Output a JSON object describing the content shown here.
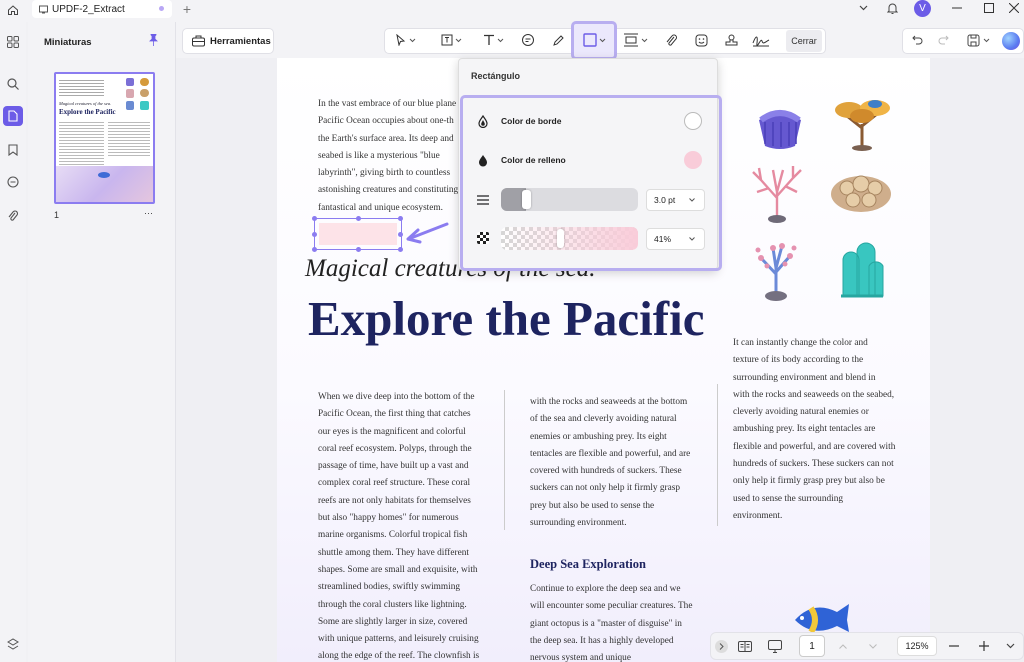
{
  "tab": {
    "title": "UPDF-2_Extract"
  },
  "thumbnails": {
    "title": "Miniaturas",
    "page_number": "1",
    "more": "···",
    "mini_subtitle": "Magical creatures of the sea.",
    "mini_title": "Explore the Pacific"
  },
  "toolbar": {
    "tools_label": "Herramientas",
    "close_label": "Cerrar"
  },
  "popup": {
    "title": "Rectángulo",
    "border_color_label": "Color de borde",
    "fill_color_label": "Color de relleno",
    "thickness_value": "3.0 pt",
    "opacity_value": "41%",
    "thickness_level": 0.15,
    "opacity_level": 0.41,
    "border_color": "#ffffff",
    "fill_color": "#f9ccd9"
  },
  "page": {
    "intro_lines": [
      "In the vast embrace of our blue plane",
      "Pacific Ocean occupies about one-th",
      "the Earth's surface area. Its deep and",
      "seabed is like a mysterious \"blue",
      "labyrinth\", giving birth to countless",
      "astonishing creatures and constituting",
      "fantastical and unique ecosystem."
    ],
    "subtitle": "Magical creatures of the sea.",
    "title": "Explore the Pacific",
    "col1_lines": [
      "When we dive deep into the bottom of the",
      "Pacific Ocean, the first thing that catches",
      "our eyes is the magnificent and colorful",
      "coral reef ecosystem. Polyps, through the",
      "passage of time, have built up a vast and",
      "complex coral reef structure. These coral",
      "reefs are not only habitats for themselves",
      "but also \"happy homes\" for numerous",
      "marine organisms. Colorful tropical fish",
      "shuttle among them. They have different",
      "shapes. Some are small and exquisite, with",
      "streamlined bodies, swiftly swimming",
      "through the coral clusters like lightning.",
      "Some are slightly larger in size, covered",
      "with unique patterns, and leisurely cruising",
      "along the edge of the reef. The clownfish is"
    ],
    "col2_lines": [
      "with the rocks and seaweeds at the bottom",
      "of the sea and cleverly avoiding natural",
      "enemies or ambushing prey. Its eight",
      "tentacles are flexible and powerful, and are",
      "covered with hundreds of suckers. These",
      "suckers can not only help it firmly grasp",
      "prey but also be used to sense the",
      "surrounding environment."
    ],
    "deep_sea_heading": "Deep Sea Exploration",
    "col2b_lines": [
      "Continue to explore the deep sea and we",
      "will encounter some peculiar creatures. The",
      "giant octopus is a \"master of disguise\" in",
      "the deep sea. It has a highly developed",
      "nervous system and unique"
    ],
    "col3_lines": [
      "It can instantly change the color and",
      "texture of its body according to the",
      "surrounding environment and blend in",
      "with the rocks and seaweeds on the seabed,",
      "cleverly avoiding natural enemies or",
      "ambushing prey. Its eight tentacles are",
      "flexible and powerful, and are covered with",
      "hundreds of suckers. These suckers can not",
      "only help it firmly grasp prey but also be",
      "used to sense the surrounding",
      "environment."
    ]
  },
  "bottombar": {
    "page_input": "1",
    "zoom": "125%"
  },
  "colors": {
    "accent": "#b8aef0",
    "brand": "#6c5ce7",
    "title_navy": "#1e2460",
    "shape_fill": "#fde3e8"
  },
  "icons": [
    "home-icon",
    "document-icon",
    "plus-icon",
    "chevron-down-icon",
    "bell-icon",
    "avatar",
    "minimize-icon",
    "maximize-icon",
    "close-icon",
    "grid-icon",
    "search-icon",
    "pages-icon",
    "bookmark-icon",
    "comment-icon",
    "attachment-icon",
    "pin-icon",
    "layers-icon",
    "toolbox-icon",
    "cursor-icon",
    "textbox-icon",
    "text-icon",
    "comment-bubble-icon",
    "pencil-icon",
    "rectangle-icon",
    "measure-icon",
    "paperclip-icon",
    "sticker-icon",
    "stamp-icon",
    "signature-icon",
    "undo-icon",
    "redo-icon",
    "save-icon",
    "ai-assistant-icon",
    "drop-outline-icon",
    "drop-filled-icon",
    "line-thickness-icon",
    "checker-icon",
    "arrow-icon",
    "collapse-icon",
    "reading-mode-icon",
    "presentation-icon",
    "page-up-icon",
    "page-down-icon",
    "zoom-out-icon",
    "zoom-in-icon"
  ],
  "avatar_initial": "V"
}
